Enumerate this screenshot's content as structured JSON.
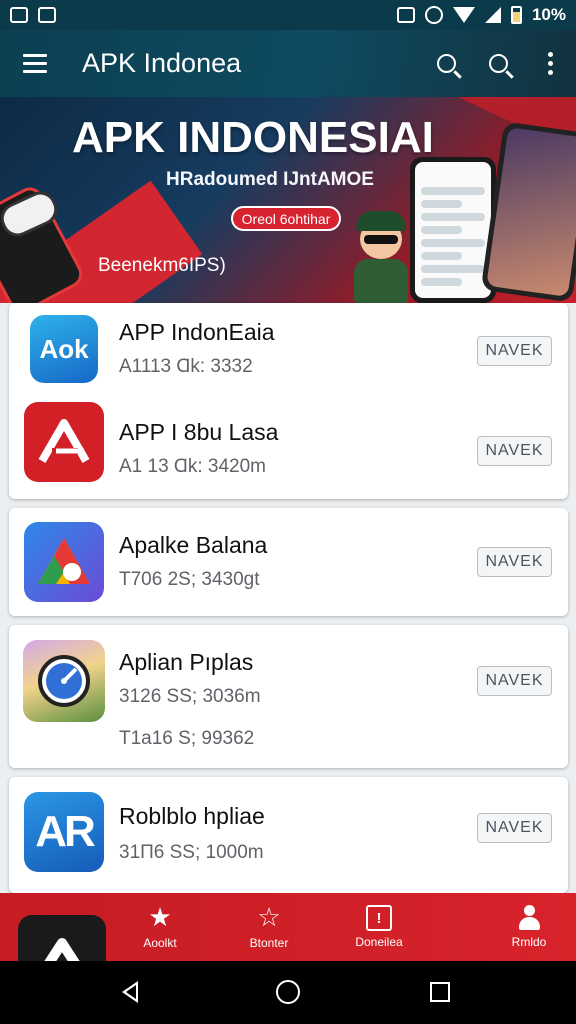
{
  "status_bar": {
    "battery": "10%"
  },
  "app_bar": {
    "title": "APK Indonea"
  },
  "banner": {
    "title": "APK INDONESIAI",
    "subtitle": "HRadoumed IJntAMOE",
    "button": "Oreol 6ohtihar",
    "footer": "Beenekm6IPS)"
  },
  "apps": [
    {
      "name": "APP IndonEaia",
      "meta": "A1113 Ɑk: 3332",
      "action": "NAVEK",
      "icon": "Aok"
    },
    {
      "name": "APP I 8bu Lasa",
      "meta": "A1 13 Ɑk: 3420m",
      "action": "NAVEK",
      "icon": "red-a-logo"
    },
    {
      "name": "Apalke Balana",
      "meta": "T706 2S; 3430gt",
      "action": "NAVEK",
      "icon": "triangle-logo"
    },
    {
      "name": "Aplian Pıplas",
      "meta": "3126 SS; 3036m",
      "meta2": "T1a16 S; 99362",
      "action": "NAVEK",
      "icon": "compass-photo"
    },
    {
      "name": "Roblblo hpliae",
      "meta": "31П6 SS; 1000m",
      "action": "NAVEK",
      "icon": "AR"
    }
  ],
  "bottom_nav": {
    "items": [
      {
        "label": "Aoolkt",
        "icon": "star-icon"
      },
      {
        "label": "Btonter",
        "icon": "star-outline-icon"
      },
      {
        "label": "Doneilea",
        "icon": "box-icon"
      },
      {
        "label": "Rmldo",
        "icon": "people-icon"
      }
    ]
  }
}
